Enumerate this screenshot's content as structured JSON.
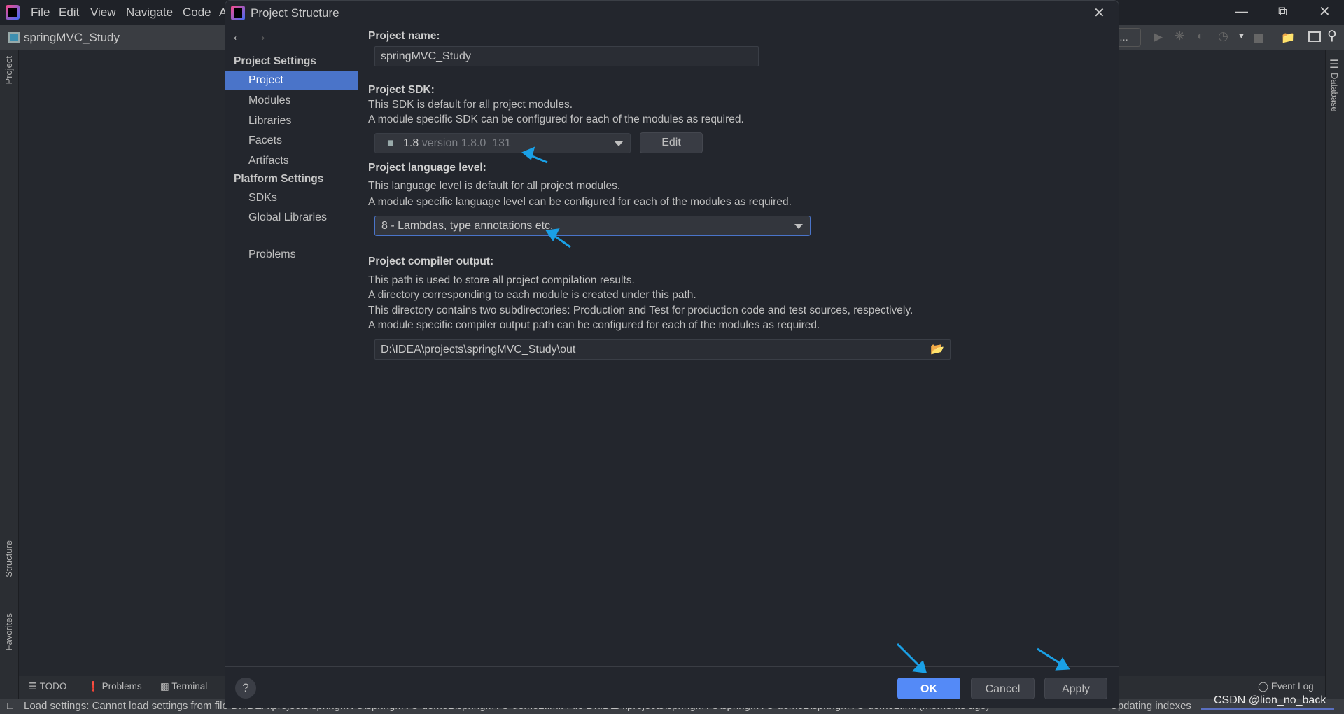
{
  "ide": {
    "menu": [
      "File",
      "Edit",
      "View",
      "Navigate",
      "Code",
      "A"
    ],
    "project_name": "springMVC_Study",
    "search_hint": "n...",
    "left_tools": [
      "Project",
      "Structure",
      "Favorites"
    ],
    "right_tools": [
      "Database"
    ],
    "bottom_tools": [
      "TODO",
      "Problems",
      "Terminal"
    ],
    "event_log": "Event Log",
    "status_message": "Load settings: Cannot load settings from file D:\\IDEA\\projects\\springMVC\\springMVC-demo2\\springMVC-demo2.iml: File D:\\IDEA\\projects\\springMVC\\springMVC-demo2\\springMVC-demo2.iml (moments ago)",
    "status_right": "Updating indexes",
    "watermark": "CSDN @lion_no_back"
  },
  "dialog": {
    "title": "Project Structure",
    "sidebar": {
      "group1": "Project Settings",
      "items1": [
        "Project",
        "Modules",
        "Libraries",
        "Facets",
        "Artifacts"
      ],
      "group2": "Platform Settings",
      "items2": [
        "SDKs",
        "Global Libraries"
      ],
      "problems": "Problems",
      "selected": "Project"
    },
    "content": {
      "name_label": "Project name:",
      "name_value": "springMVC_Study",
      "sdk_label": "Project SDK:",
      "sdk_desc1": "This SDK is default for all project modules.",
      "sdk_desc2": "A module specific SDK can be configured for each of the modules as required.",
      "sdk_name": "1.8",
      "sdk_version": "version 1.8.0_131",
      "edit_button": "Edit",
      "lang_label": "Project language level:",
      "lang_desc1": "This language level is default for all project modules.",
      "lang_desc2": "A module specific language level can be configured for each of the modules as required.",
      "lang_value": "8 - Lambdas, type annotations etc.",
      "out_label": "Project compiler output:",
      "out_desc1": "This path is used to store all project compilation results.",
      "out_desc2": "A directory corresponding to each module is created under this path.",
      "out_desc3": "This directory contains two subdirectories: Production and Test for production code and test sources, respectively.",
      "out_desc4": "A module specific compiler output path can be configured for each of the modules as required.",
      "out_value": "D:\\IDEA\\projects\\springMVC_Study\\out"
    },
    "footer": {
      "help": "?",
      "ok": "OK",
      "cancel": "Cancel",
      "apply": "Apply"
    }
  },
  "colors": {
    "accent": "#4a74c9",
    "ok_button": "#548af7",
    "annotation_arrow": "#1aa0e6"
  }
}
